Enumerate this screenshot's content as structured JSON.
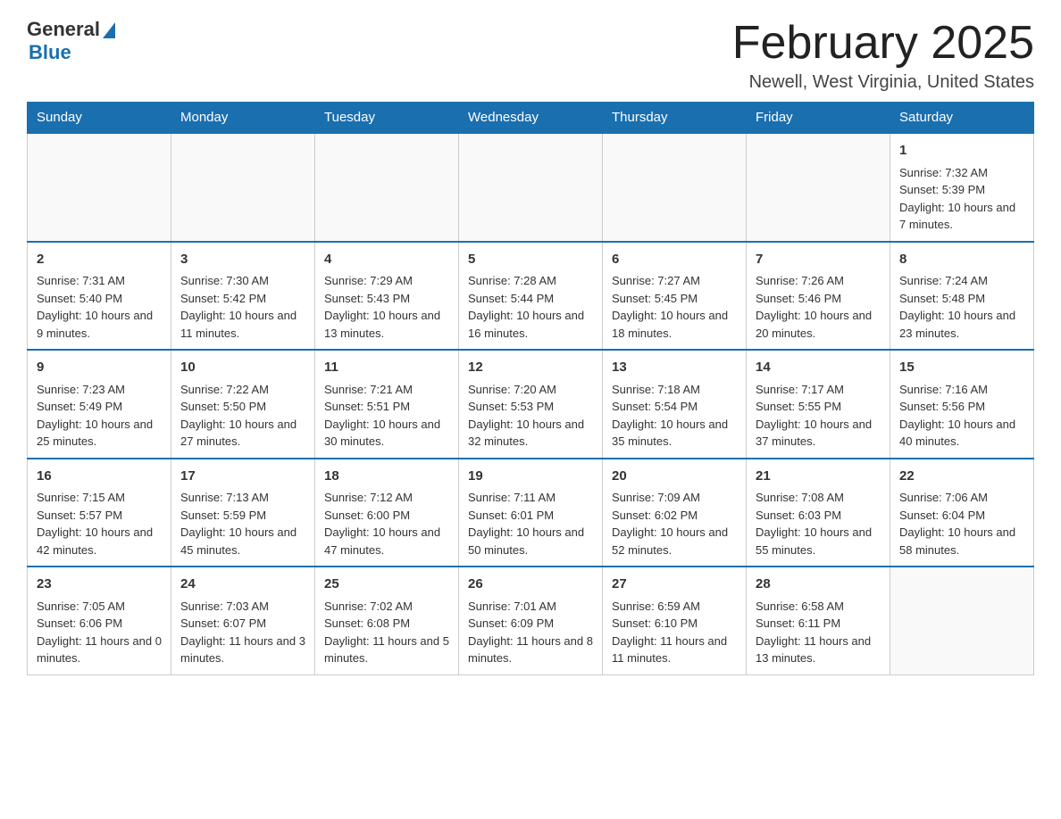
{
  "header": {
    "logo_general": "General",
    "logo_blue": "Blue",
    "title": "February 2025",
    "location": "Newell, West Virginia, United States"
  },
  "days_of_week": [
    "Sunday",
    "Monday",
    "Tuesday",
    "Wednesday",
    "Thursday",
    "Friday",
    "Saturday"
  ],
  "weeks": [
    [
      {
        "day": "",
        "sunrise": "",
        "sunset": "",
        "daylight": "",
        "empty": true
      },
      {
        "day": "",
        "sunrise": "",
        "sunset": "",
        "daylight": "",
        "empty": true
      },
      {
        "day": "",
        "sunrise": "",
        "sunset": "",
        "daylight": "",
        "empty": true
      },
      {
        "day": "",
        "sunrise": "",
        "sunset": "",
        "daylight": "",
        "empty": true
      },
      {
        "day": "",
        "sunrise": "",
        "sunset": "",
        "daylight": "",
        "empty": true
      },
      {
        "day": "",
        "sunrise": "",
        "sunset": "",
        "daylight": "",
        "empty": true
      },
      {
        "day": "1",
        "sunrise": "Sunrise: 7:32 AM",
        "sunset": "Sunset: 5:39 PM",
        "daylight": "Daylight: 10 hours and 7 minutes.",
        "empty": false
      }
    ],
    [
      {
        "day": "2",
        "sunrise": "Sunrise: 7:31 AM",
        "sunset": "Sunset: 5:40 PM",
        "daylight": "Daylight: 10 hours and 9 minutes.",
        "empty": false
      },
      {
        "day": "3",
        "sunrise": "Sunrise: 7:30 AM",
        "sunset": "Sunset: 5:42 PM",
        "daylight": "Daylight: 10 hours and 11 minutes.",
        "empty": false
      },
      {
        "day": "4",
        "sunrise": "Sunrise: 7:29 AM",
        "sunset": "Sunset: 5:43 PM",
        "daylight": "Daylight: 10 hours and 13 minutes.",
        "empty": false
      },
      {
        "day": "5",
        "sunrise": "Sunrise: 7:28 AM",
        "sunset": "Sunset: 5:44 PM",
        "daylight": "Daylight: 10 hours and 16 minutes.",
        "empty": false
      },
      {
        "day": "6",
        "sunrise": "Sunrise: 7:27 AM",
        "sunset": "Sunset: 5:45 PM",
        "daylight": "Daylight: 10 hours and 18 minutes.",
        "empty": false
      },
      {
        "day": "7",
        "sunrise": "Sunrise: 7:26 AM",
        "sunset": "Sunset: 5:46 PM",
        "daylight": "Daylight: 10 hours and 20 minutes.",
        "empty": false
      },
      {
        "day": "8",
        "sunrise": "Sunrise: 7:24 AM",
        "sunset": "Sunset: 5:48 PM",
        "daylight": "Daylight: 10 hours and 23 minutes.",
        "empty": false
      }
    ],
    [
      {
        "day": "9",
        "sunrise": "Sunrise: 7:23 AM",
        "sunset": "Sunset: 5:49 PM",
        "daylight": "Daylight: 10 hours and 25 minutes.",
        "empty": false
      },
      {
        "day": "10",
        "sunrise": "Sunrise: 7:22 AM",
        "sunset": "Sunset: 5:50 PM",
        "daylight": "Daylight: 10 hours and 27 minutes.",
        "empty": false
      },
      {
        "day": "11",
        "sunrise": "Sunrise: 7:21 AM",
        "sunset": "Sunset: 5:51 PM",
        "daylight": "Daylight: 10 hours and 30 minutes.",
        "empty": false
      },
      {
        "day": "12",
        "sunrise": "Sunrise: 7:20 AM",
        "sunset": "Sunset: 5:53 PM",
        "daylight": "Daylight: 10 hours and 32 minutes.",
        "empty": false
      },
      {
        "day": "13",
        "sunrise": "Sunrise: 7:18 AM",
        "sunset": "Sunset: 5:54 PM",
        "daylight": "Daylight: 10 hours and 35 minutes.",
        "empty": false
      },
      {
        "day": "14",
        "sunrise": "Sunrise: 7:17 AM",
        "sunset": "Sunset: 5:55 PM",
        "daylight": "Daylight: 10 hours and 37 minutes.",
        "empty": false
      },
      {
        "day": "15",
        "sunrise": "Sunrise: 7:16 AM",
        "sunset": "Sunset: 5:56 PM",
        "daylight": "Daylight: 10 hours and 40 minutes.",
        "empty": false
      }
    ],
    [
      {
        "day": "16",
        "sunrise": "Sunrise: 7:15 AM",
        "sunset": "Sunset: 5:57 PM",
        "daylight": "Daylight: 10 hours and 42 minutes.",
        "empty": false
      },
      {
        "day": "17",
        "sunrise": "Sunrise: 7:13 AM",
        "sunset": "Sunset: 5:59 PM",
        "daylight": "Daylight: 10 hours and 45 minutes.",
        "empty": false
      },
      {
        "day": "18",
        "sunrise": "Sunrise: 7:12 AM",
        "sunset": "Sunset: 6:00 PM",
        "daylight": "Daylight: 10 hours and 47 minutes.",
        "empty": false
      },
      {
        "day": "19",
        "sunrise": "Sunrise: 7:11 AM",
        "sunset": "Sunset: 6:01 PM",
        "daylight": "Daylight: 10 hours and 50 minutes.",
        "empty": false
      },
      {
        "day": "20",
        "sunrise": "Sunrise: 7:09 AM",
        "sunset": "Sunset: 6:02 PM",
        "daylight": "Daylight: 10 hours and 52 minutes.",
        "empty": false
      },
      {
        "day": "21",
        "sunrise": "Sunrise: 7:08 AM",
        "sunset": "Sunset: 6:03 PM",
        "daylight": "Daylight: 10 hours and 55 minutes.",
        "empty": false
      },
      {
        "day": "22",
        "sunrise": "Sunrise: 7:06 AM",
        "sunset": "Sunset: 6:04 PM",
        "daylight": "Daylight: 10 hours and 58 minutes.",
        "empty": false
      }
    ],
    [
      {
        "day": "23",
        "sunrise": "Sunrise: 7:05 AM",
        "sunset": "Sunset: 6:06 PM",
        "daylight": "Daylight: 11 hours and 0 minutes.",
        "empty": false
      },
      {
        "day": "24",
        "sunrise": "Sunrise: 7:03 AM",
        "sunset": "Sunset: 6:07 PM",
        "daylight": "Daylight: 11 hours and 3 minutes.",
        "empty": false
      },
      {
        "day": "25",
        "sunrise": "Sunrise: 7:02 AM",
        "sunset": "Sunset: 6:08 PM",
        "daylight": "Daylight: 11 hours and 5 minutes.",
        "empty": false
      },
      {
        "day": "26",
        "sunrise": "Sunrise: 7:01 AM",
        "sunset": "Sunset: 6:09 PM",
        "daylight": "Daylight: 11 hours and 8 minutes.",
        "empty": false
      },
      {
        "day": "27",
        "sunrise": "Sunrise: 6:59 AM",
        "sunset": "Sunset: 6:10 PM",
        "daylight": "Daylight: 11 hours and 11 minutes.",
        "empty": false
      },
      {
        "day": "28",
        "sunrise": "Sunrise: 6:58 AM",
        "sunset": "Sunset: 6:11 PM",
        "daylight": "Daylight: 11 hours and 13 minutes.",
        "empty": false
      },
      {
        "day": "",
        "sunrise": "",
        "sunset": "",
        "daylight": "",
        "empty": true
      }
    ]
  ]
}
